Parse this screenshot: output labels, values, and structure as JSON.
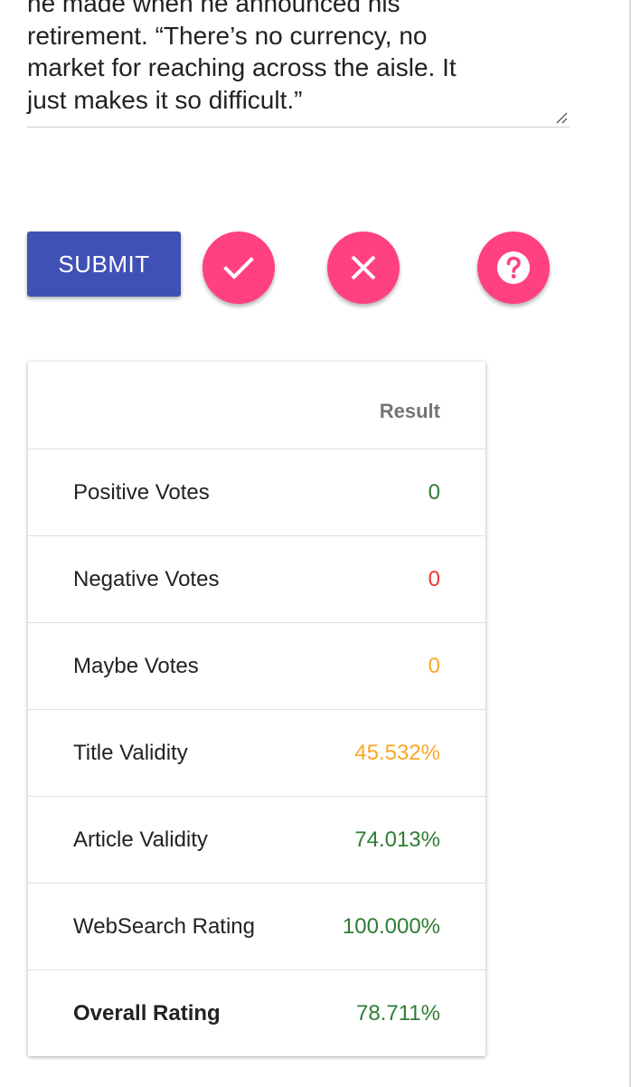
{
  "article": {
    "text_lines": [
      "he made when he announced his",
      "retirement. “There’s no currency, no",
      "market for reaching across the aisle. It",
      "just makes it so difficult.”"
    ]
  },
  "actions": {
    "submit_label": "SUBMIT",
    "yes_icon": "check-icon",
    "no_icon": "close-icon",
    "maybe_icon": "help-icon",
    "fab_color": "#ff4081",
    "submit_color": "#3f51b5"
  },
  "results": {
    "column_header": "Result",
    "rows": [
      {
        "label": "Positive Votes",
        "value": "0",
        "color": "#2e7d32",
        "bold": false
      },
      {
        "label": "Negative Votes",
        "value": "0",
        "color": "#e53935",
        "bold": false
      },
      {
        "label": "Maybe Votes",
        "value": "0",
        "color": "#f9a825",
        "bold": false
      },
      {
        "label": "Title Validity",
        "value": "45.532%",
        "color": "#f9a825",
        "bold": false
      },
      {
        "label": "Article Validity",
        "value": "74.013%",
        "color": "#2e7d32",
        "bold": false
      },
      {
        "label": "WebSearch Rating",
        "value": "100.000%",
        "color": "#2e7d32",
        "bold": false
      },
      {
        "label": "Overall Rating",
        "value": "78.711%",
        "color": "#2e7d32",
        "bold": true
      }
    ]
  }
}
